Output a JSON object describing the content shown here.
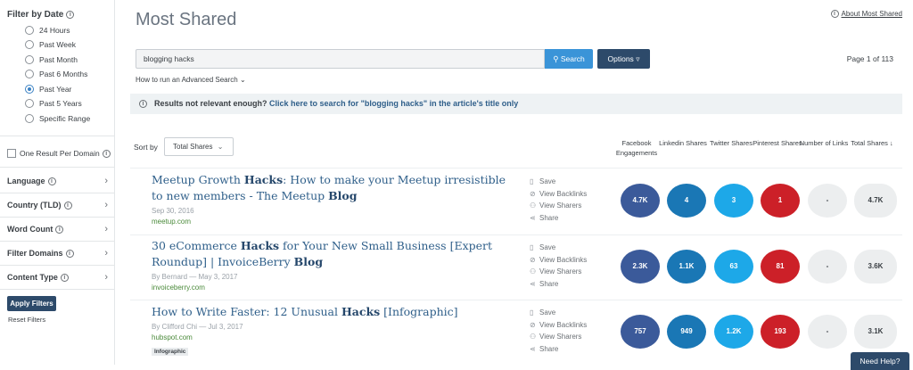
{
  "sidebar": {
    "filter_by_date": "Filter by Date",
    "date_options": [
      {
        "label": "24 Hours",
        "selected": false
      },
      {
        "label": "Past Week",
        "selected": false
      },
      {
        "label": "Past Month",
        "selected": false
      },
      {
        "label": "Past 6 Months",
        "selected": false
      },
      {
        "label": "Past Year",
        "selected": true
      },
      {
        "label": "Past 5 Years",
        "selected": false
      },
      {
        "label": "Specific Range",
        "selected": false
      }
    ],
    "one_result_per_domain": "One Result Per Domain",
    "accordions": [
      "Language",
      "Country (TLD)",
      "Word Count",
      "Filter Domains",
      "Content Type"
    ],
    "apply_label": "Apply Filters",
    "reset_label": "Reset Filters"
  },
  "header": {
    "title": "Most Shared",
    "about_link": "About Most Shared"
  },
  "search": {
    "query": "blogging hacks",
    "search_label": "Search",
    "options_label": "Options",
    "page_info": "Page 1 of 113",
    "advanced_link": "How to run an Advanced Search"
  },
  "banner": {
    "prefix": "Results not relevant enough?",
    "link": "Click here to search for \"blogging hacks\" in the article's title only"
  },
  "sort": {
    "label": "Sort by",
    "value": "Total Shares"
  },
  "columns": {
    "facebook": "Facebook Engagements",
    "linkedin": "Linkedin Shares",
    "twitter": "Twitter Shares",
    "pinterest": "Pinterest Shares",
    "links": "Number of Links",
    "total": "Total Shares"
  },
  "actions": {
    "save": "Save",
    "backlinks": "View Backlinks",
    "sharers": "View Sharers",
    "share": "Share"
  },
  "articles": [
    {
      "title_parts": [
        "Meetup Growth ",
        "Hacks",
        ": How to make your Meetup irresistible to new members - The Meetup ",
        "Blog"
      ],
      "meta": "Sep 30, 2016",
      "domain": "meetup.com",
      "tag": "",
      "facebook": "4.7K",
      "linkedin": "4",
      "twitter": "3",
      "pinterest": "1",
      "links": "-",
      "total": "4.7K"
    },
    {
      "title_parts": [
        "30 eCommerce ",
        "Hacks",
        " for Your New Small Business [Expert Roundup] | InvoiceBerry ",
        "Blog"
      ],
      "meta": "By Bernard — May 3, 2017",
      "domain": "invoiceberry.com",
      "tag": "",
      "facebook": "2.3K",
      "linkedin": "1.1K",
      "twitter": "63",
      "pinterest": "81",
      "links": "-",
      "total": "3.6K"
    },
    {
      "title_parts": [
        "How to Write Faster: 12 Unusual ",
        "Hacks",
        " [Infographic]",
        ""
      ],
      "meta": "By Clifford Chi — Jul 3, 2017",
      "domain": "hubspot.com",
      "tag": "Infographic",
      "facebook": "757",
      "linkedin": "949",
      "twitter": "1.2K",
      "pinterest": "193",
      "links": "-",
      "total": "3.1K"
    }
  ],
  "help_label": "Need Help?",
  "colors": {
    "facebook": "#3b5a9a",
    "linkedin": "#1a77b5",
    "twitter": "#1da8e8",
    "pinterest": "#cc2028",
    "accent": "#3a94d8",
    "dark": "#2d4a6a"
  }
}
